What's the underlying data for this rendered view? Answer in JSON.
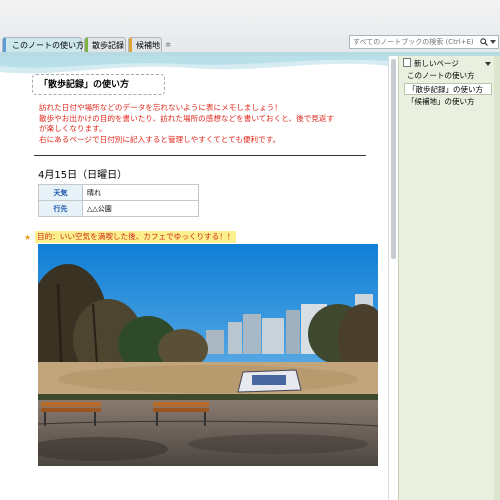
{
  "tabs": [
    {
      "label": "このノートの使い方",
      "color": "#5b9ed6",
      "active": true
    },
    {
      "label": "散歩記録",
      "color": "#7cb342",
      "active": false
    },
    {
      "label": "候補地",
      "color": "#e0a43a",
      "active": false
    }
  ],
  "tab_add_glyph": "✲",
  "search": {
    "placeholder": "すべてのノートブックの検索 (Ctrl+E)",
    "icon": "search-icon"
  },
  "sidebar": {
    "new_page_label": "新しいページ",
    "items": [
      {
        "label": "このノートの使い方",
        "selected": false
      },
      {
        "label": "「散歩記録」の使い方",
        "selected": true
      },
      {
        "label": "「候補地」の使い方",
        "selected": false
      }
    ]
  },
  "page": {
    "title": "「散歩記録」の使い方",
    "intro": [
      "訪れた日付や場所などのデータを忘れないように表にメモしましょう！",
      "散歩やお出かけの目的を書いたり、訪れた場所の感想などを書いておくと、後で見返す",
      "が楽しくなります。",
      "右にあるページで日付別に記入すると管理しやすくてとても便利です。"
    ],
    "date": "4月15日（日曜日）",
    "table": [
      {
        "key": "天気",
        "value": "晴れ"
      },
      {
        "key": "行先",
        "value": "△△公園"
      }
    ],
    "goal": "目的：いい空気を満喫した後、カフェでゆっくりする！！"
  },
  "colors": {
    "accent": "#b6dbe3",
    "intro_text": "#e0281c",
    "highlight": "#fbf08c",
    "table_key": "#1a56a8",
    "sidebar_bg": "#e9f0df"
  }
}
